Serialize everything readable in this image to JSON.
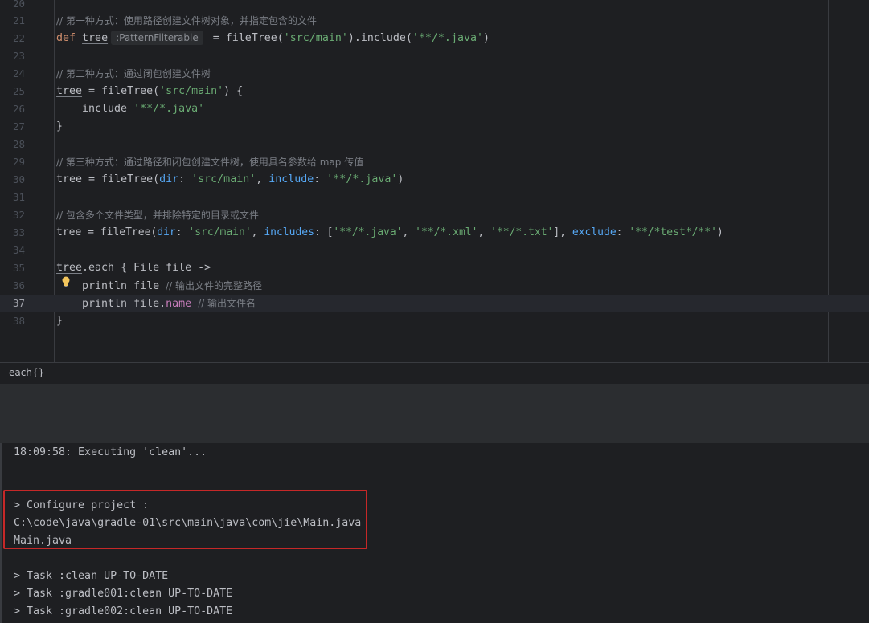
{
  "editor": {
    "lines": [
      {
        "n": "20"
      },
      {
        "n": "21",
        "comment": "// 第一种方式：使用路径创建文件树对象，并指定包含的文件"
      },
      {
        "n": "22",
        "kw": "def",
        "var": "tree",
        "hint": ":PatternFilterable",
        "rest1": " = fileTree(",
        "str1": "'src/main'",
        "rest2": ").include(",
        "str2": "'**/*.java'",
        "rest3": ")"
      },
      {
        "n": "23"
      },
      {
        "n": "24",
        "comment": "// 第二种方式：通过闭包创建文件树"
      },
      {
        "n": "25",
        "var": "tree",
        "rest1": " = fileTree(",
        "str1": "'src/main'",
        "rest2": ") {"
      },
      {
        "n": "26",
        "rest1": "    include ",
        "str1": "'**/*.java'"
      },
      {
        "n": "27",
        "rest1": "}"
      },
      {
        "n": "28"
      },
      {
        "n": "29",
        "comment": "// 第三种方式：通过路径和闭包创建文件树，使用具名参数给 map 传值"
      },
      {
        "n": "30",
        "var": "tree",
        "rest1": " = fileTree(",
        "p1": "dir",
        "rest2": ": ",
        "str1": "'src/main'",
        "rest3": ", ",
        "p2": "include",
        "rest4": ": ",
        "str2": "'**/*.java'",
        "rest5": ")"
      },
      {
        "n": "31"
      },
      {
        "n": "32",
        "comment": "// 包含多个文件类型，并排除特定的目录或文件"
      },
      {
        "n": "33",
        "var": "tree",
        "rest1": " = fileTree(",
        "p1": "dir",
        "rest2": ": ",
        "str1": "'src/main'",
        "rest3": ", ",
        "p2": "includes",
        "rest4": ": [",
        "str2": "'**/*.java'",
        "rest5": ", ",
        "str3": "'**/*.xml'",
        "rest6": ", ",
        "str4": "'**/*.txt'",
        "rest7": "], ",
        "p3": "exclude",
        "rest8": ": ",
        "str5": "'**/*test*/**'",
        "rest9": ")"
      },
      {
        "n": "34"
      },
      {
        "n": "35",
        "var": "tree",
        "rest1": ".each { File file ->"
      },
      {
        "n": "36",
        "rest1": "    println file ",
        "comment": "// 输出文件的完整路径"
      },
      {
        "n": "37",
        "rest1": "    println file.",
        "prop": "name",
        "rest2": " ",
        "comment": "// 输出文件名"
      },
      {
        "n": "38",
        "rest1": "}"
      }
    ]
  },
  "breadcrumb": {
    "label": "each{}"
  },
  "console": {
    "lines": [
      "18:09:58: Executing 'clean'...",
      "> Configure project :",
      "C:\\code\\java\\gradle-01\\src\\main\\java\\com\\jie\\Main.java",
      "Main.java",
      "> Task :clean UP-TO-DATE",
      "> Task :gradle001:clean UP-TO-DATE",
      "> Task :gradle002:clean UP-TO-DATE"
    ]
  },
  "colors": {
    "highlight_border": "#c62828",
    "string": "#6aab73",
    "keyword": "#cf8e6d",
    "comment": "#7a7e85"
  },
  "icons": {
    "bulb": "lightbulb-icon"
  }
}
